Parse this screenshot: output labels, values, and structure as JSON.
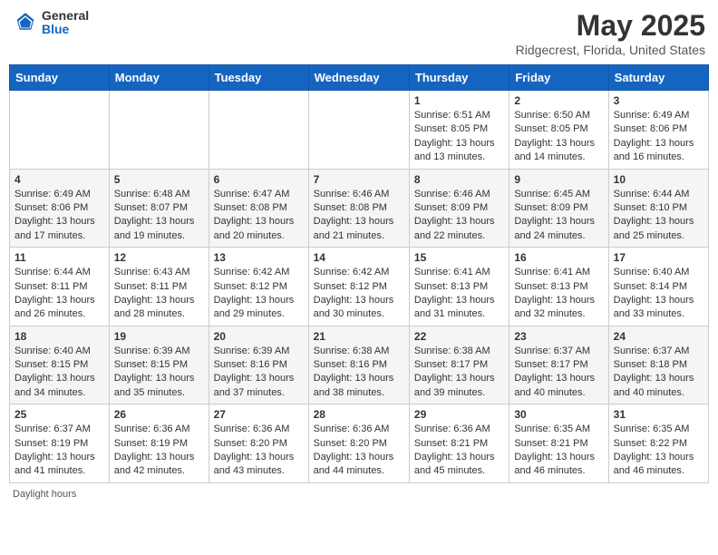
{
  "header": {
    "logo_general": "General",
    "logo_blue": "Blue",
    "month_title": "May 2025",
    "location": "Ridgecrest, Florida, United States"
  },
  "weekdays": [
    "Sunday",
    "Monday",
    "Tuesday",
    "Wednesday",
    "Thursday",
    "Friday",
    "Saturday"
  ],
  "weeks": [
    [
      {
        "day": "",
        "info": ""
      },
      {
        "day": "",
        "info": ""
      },
      {
        "day": "",
        "info": ""
      },
      {
        "day": "",
        "info": ""
      },
      {
        "day": "1",
        "info": "Sunrise: 6:51 AM\nSunset: 8:05 PM\nDaylight: 13 hours\nand 13 minutes."
      },
      {
        "day": "2",
        "info": "Sunrise: 6:50 AM\nSunset: 8:05 PM\nDaylight: 13 hours\nand 14 minutes."
      },
      {
        "day": "3",
        "info": "Sunrise: 6:49 AM\nSunset: 8:06 PM\nDaylight: 13 hours\nand 16 minutes."
      }
    ],
    [
      {
        "day": "4",
        "info": "Sunrise: 6:49 AM\nSunset: 8:06 PM\nDaylight: 13 hours\nand 17 minutes."
      },
      {
        "day": "5",
        "info": "Sunrise: 6:48 AM\nSunset: 8:07 PM\nDaylight: 13 hours\nand 19 minutes."
      },
      {
        "day": "6",
        "info": "Sunrise: 6:47 AM\nSunset: 8:08 PM\nDaylight: 13 hours\nand 20 minutes."
      },
      {
        "day": "7",
        "info": "Sunrise: 6:46 AM\nSunset: 8:08 PM\nDaylight: 13 hours\nand 21 minutes."
      },
      {
        "day": "8",
        "info": "Sunrise: 6:46 AM\nSunset: 8:09 PM\nDaylight: 13 hours\nand 22 minutes."
      },
      {
        "day": "9",
        "info": "Sunrise: 6:45 AM\nSunset: 8:09 PM\nDaylight: 13 hours\nand 24 minutes."
      },
      {
        "day": "10",
        "info": "Sunrise: 6:44 AM\nSunset: 8:10 PM\nDaylight: 13 hours\nand 25 minutes."
      }
    ],
    [
      {
        "day": "11",
        "info": "Sunrise: 6:44 AM\nSunset: 8:11 PM\nDaylight: 13 hours\nand 26 minutes."
      },
      {
        "day": "12",
        "info": "Sunrise: 6:43 AM\nSunset: 8:11 PM\nDaylight: 13 hours\nand 28 minutes."
      },
      {
        "day": "13",
        "info": "Sunrise: 6:42 AM\nSunset: 8:12 PM\nDaylight: 13 hours\nand 29 minutes."
      },
      {
        "day": "14",
        "info": "Sunrise: 6:42 AM\nSunset: 8:12 PM\nDaylight: 13 hours\nand 30 minutes."
      },
      {
        "day": "15",
        "info": "Sunrise: 6:41 AM\nSunset: 8:13 PM\nDaylight: 13 hours\nand 31 minutes."
      },
      {
        "day": "16",
        "info": "Sunrise: 6:41 AM\nSunset: 8:13 PM\nDaylight: 13 hours\nand 32 minutes."
      },
      {
        "day": "17",
        "info": "Sunrise: 6:40 AM\nSunset: 8:14 PM\nDaylight: 13 hours\nand 33 minutes."
      }
    ],
    [
      {
        "day": "18",
        "info": "Sunrise: 6:40 AM\nSunset: 8:15 PM\nDaylight: 13 hours\nand 34 minutes."
      },
      {
        "day": "19",
        "info": "Sunrise: 6:39 AM\nSunset: 8:15 PM\nDaylight: 13 hours\nand 35 minutes."
      },
      {
        "day": "20",
        "info": "Sunrise: 6:39 AM\nSunset: 8:16 PM\nDaylight: 13 hours\nand 37 minutes."
      },
      {
        "day": "21",
        "info": "Sunrise: 6:38 AM\nSunset: 8:16 PM\nDaylight: 13 hours\nand 38 minutes."
      },
      {
        "day": "22",
        "info": "Sunrise: 6:38 AM\nSunset: 8:17 PM\nDaylight: 13 hours\nand 39 minutes."
      },
      {
        "day": "23",
        "info": "Sunrise: 6:37 AM\nSunset: 8:17 PM\nDaylight: 13 hours\nand 40 minutes."
      },
      {
        "day": "24",
        "info": "Sunrise: 6:37 AM\nSunset: 8:18 PM\nDaylight: 13 hours\nand 40 minutes."
      }
    ],
    [
      {
        "day": "25",
        "info": "Sunrise: 6:37 AM\nSunset: 8:19 PM\nDaylight: 13 hours\nand 41 minutes."
      },
      {
        "day": "26",
        "info": "Sunrise: 6:36 AM\nSunset: 8:19 PM\nDaylight: 13 hours\nand 42 minutes."
      },
      {
        "day": "27",
        "info": "Sunrise: 6:36 AM\nSunset: 8:20 PM\nDaylight: 13 hours\nand 43 minutes."
      },
      {
        "day": "28",
        "info": "Sunrise: 6:36 AM\nSunset: 8:20 PM\nDaylight: 13 hours\nand 44 minutes."
      },
      {
        "day": "29",
        "info": "Sunrise: 6:36 AM\nSunset: 8:21 PM\nDaylight: 13 hours\nand 45 minutes."
      },
      {
        "day": "30",
        "info": "Sunrise: 6:35 AM\nSunset: 8:21 PM\nDaylight: 13 hours\nand 46 minutes."
      },
      {
        "day": "31",
        "info": "Sunrise: 6:35 AM\nSunset: 8:22 PM\nDaylight: 13 hours\nand 46 minutes."
      }
    ]
  ],
  "footer": {
    "text": "Daylight hours"
  }
}
